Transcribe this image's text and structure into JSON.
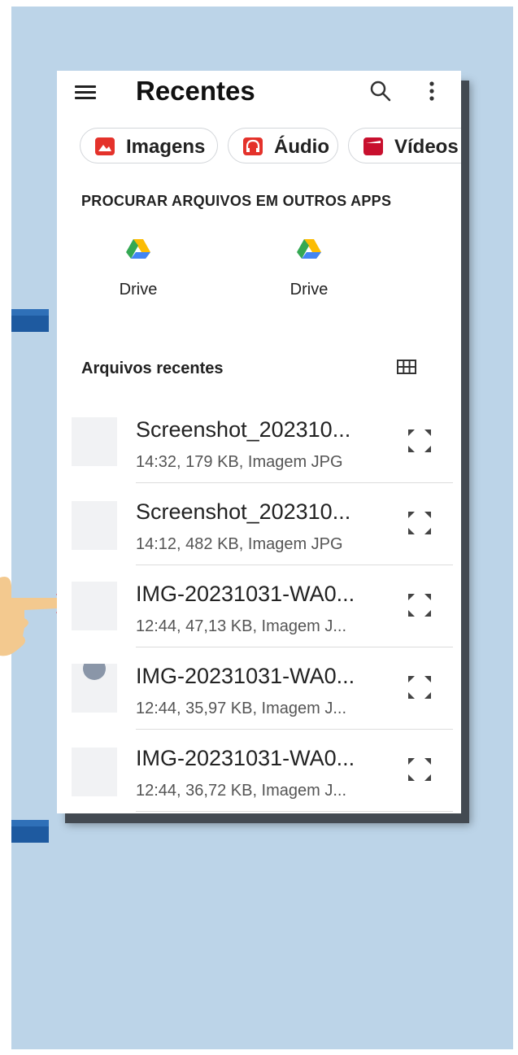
{
  "app_bar": {
    "title": "Recentes"
  },
  "chips": [
    {
      "label": "Imagens",
      "icon": "image-icon"
    },
    {
      "label": "Áudio",
      "icon": "headphones-icon"
    },
    {
      "label": "Vídeos",
      "icon": "video-icon"
    }
  ],
  "other_apps": {
    "heading": "PROCURAR ARQUIVOS EM OUTROS APPS",
    "apps": [
      {
        "label": "Drive",
        "icon": "drive-icon"
      },
      {
        "label": "Drive",
        "icon": "drive-icon"
      }
    ]
  },
  "recent": {
    "heading": "Arquivos recentes",
    "files": [
      {
        "name": "Screenshot_202310...",
        "meta": "14:32, 179 KB, Imagem JPG"
      },
      {
        "name": "Screenshot_202310...",
        "meta": "14:12, 482 KB, Imagem JPG"
      },
      {
        "name": "IMG-20231031-WA0...",
        "meta": "12:44, 47,13 KB, Imagem J..."
      },
      {
        "name": "IMG-20231031-WA0...",
        "meta": "12:44, 35,97 KB, Imagem J..."
      },
      {
        "name": "IMG-20231031-WA0...",
        "meta": "12:44, 36,72 KB, Imagem J..."
      }
    ]
  },
  "colors": {
    "background": "#bcd4e8",
    "accent_bar": "#1e5aa0",
    "chip_icon": "#e4322b"
  }
}
